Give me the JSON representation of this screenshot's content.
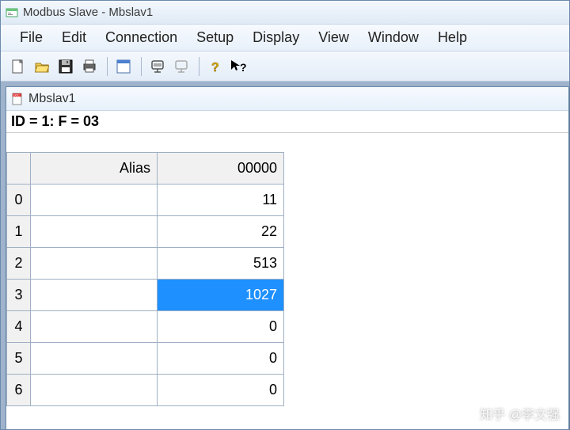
{
  "title": "Modbus Slave - Mbslav1",
  "menu": [
    "File",
    "Edit",
    "Connection",
    "Setup",
    "Display",
    "View",
    "Window",
    "Help"
  ],
  "toolbar_icons": [
    "new",
    "open",
    "save",
    "print",
    "pane",
    "connect",
    "disconnect",
    "help",
    "context-help"
  ],
  "child": {
    "title": "Mbslav1",
    "status": "ID = 1: F = 03",
    "columns": {
      "alias": "Alias",
      "value": "00000"
    },
    "rows": [
      {
        "idx": "0",
        "alias": "",
        "value": "11"
      },
      {
        "idx": "1",
        "alias": "",
        "value": "22"
      },
      {
        "idx": "2",
        "alias": "",
        "value": "513"
      },
      {
        "idx": "3",
        "alias": "",
        "value": "1027"
      },
      {
        "idx": "4",
        "alias": "",
        "value": "0"
      },
      {
        "idx": "5",
        "alias": "",
        "value": "0"
      },
      {
        "idx": "6",
        "alias": "",
        "value": "0"
      }
    ],
    "selected_row": 3
  },
  "watermark": "知乎 @李文强"
}
